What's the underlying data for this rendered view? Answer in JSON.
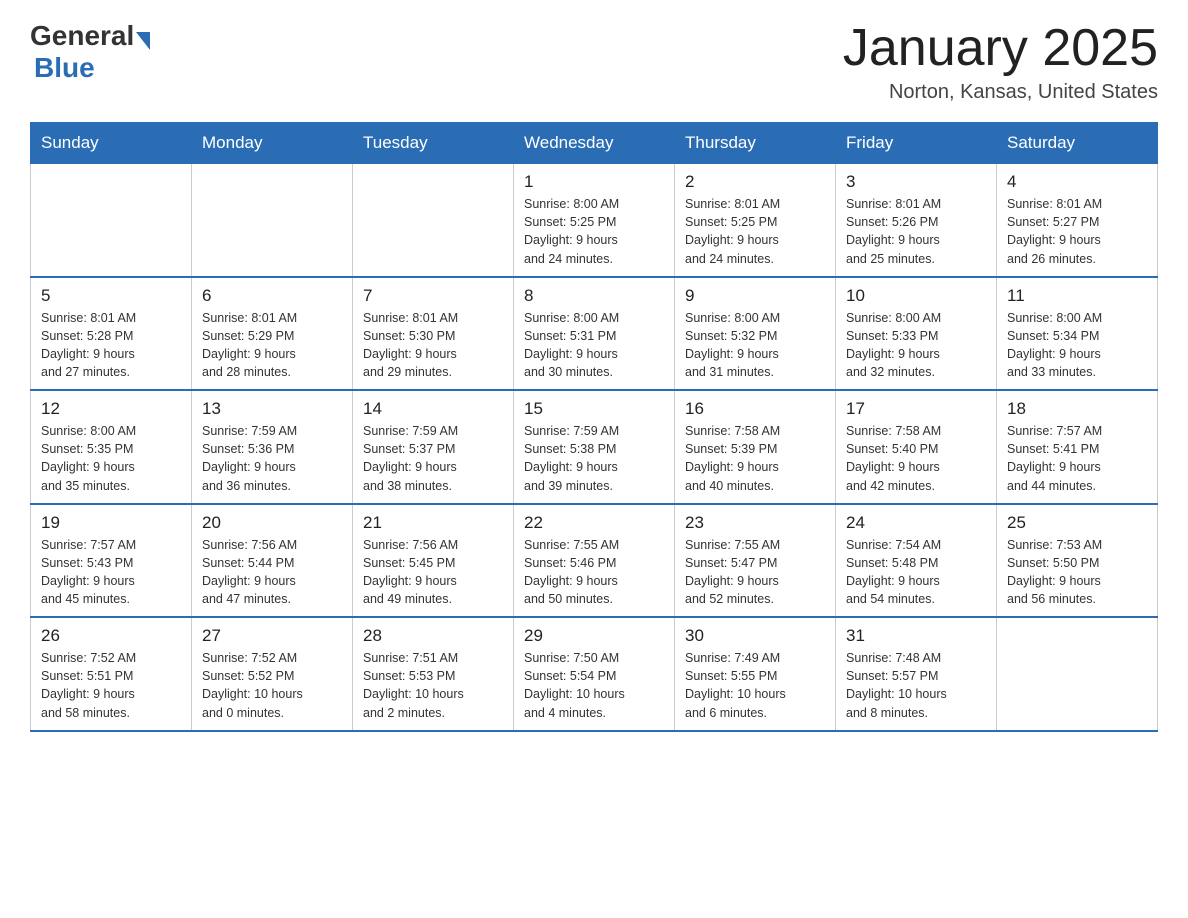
{
  "header": {
    "logo_general": "General",
    "logo_blue": "Blue",
    "month_title": "January 2025",
    "location": "Norton, Kansas, United States"
  },
  "days_of_week": [
    "Sunday",
    "Monday",
    "Tuesday",
    "Wednesday",
    "Thursday",
    "Friday",
    "Saturday"
  ],
  "weeks": [
    {
      "days": [
        {
          "num": "",
          "info": ""
        },
        {
          "num": "",
          "info": ""
        },
        {
          "num": "",
          "info": ""
        },
        {
          "num": "1",
          "info": "Sunrise: 8:00 AM\nSunset: 5:25 PM\nDaylight: 9 hours\nand 24 minutes."
        },
        {
          "num": "2",
          "info": "Sunrise: 8:01 AM\nSunset: 5:25 PM\nDaylight: 9 hours\nand 24 minutes."
        },
        {
          "num": "3",
          "info": "Sunrise: 8:01 AM\nSunset: 5:26 PM\nDaylight: 9 hours\nand 25 minutes."
        },
        {
          "num": "4",
          "info": "Sunrise: 8:01 AM\nSunset: 5:27 PM\nDaylight: 9 hours\nand 26 minutes."
        }
      ]
    },
    {
      "days": [
        {
          "num": "5",
          "info": "Sunrise: 8:01 AM\nSunset: 5:28 PM\nDaylight: 9 hours\nand 27 minutes."
        },
        {
          "num": "6",
          "info": "Sunrise: 8:01 AM\nSunset: 5:29 PM\nDaylight: 9 hours\nand 28 minutes."
        },
        {
          "num": "7",
          "info": "Sunrise: 8:01 AM\nSunset: 5:30 PM\nDaylight: 9 hours\nand 29 minutes."
        },
        {
          "num": "8",
          "info": "Sunrise: 8:00 AM\nSunset: 5:31 PM\nDaylight: 9 hours\nand 30 minutes."
        },
        {
          "num": "9",
          "info": "Sunrise: 8:00 AM\nSunset: 5:32 PM\nDaylight: 9 hours\nand 31 minutes."
        },
        {
          "num": "10",
          "info": "Sunrise: 8:00 AM\nSunset: 5:33 PM\nDaylight: 9 hours\nand 32 minutes."
        },
        {
          "num": "11",
          "info": "Sunrise: 8:00 AM\nSunset: 5:34 PM\nDaylight: 9 hours\nand 33 minutes."
        }
      ]
    },
    {
      "days": [
        {
          "num": "12",
          "info": "Sunrise: 8:00 AM\nSunset: 5:35 PM\nDaylight: 9 hours\nand 35 minutes."
        },
        {
          "num": "13",
          "info": "Sunrise: 7:59 AM\nSunset: 5:36 PM\nDaylight: 9 hours\nand 36 minutes."
        },
        {
          "num": "14",
          "info": "Sunrise: 7:59 AM\nSunset: 5:37 PM\nDaylight: 9 hours\nand 38 minutes."
        },
        {
          "num": "15",
          "info": "Sunrise: 7:59 AM\nSunset: 5:38 PM\nDaylight: 9 hours\nand 39 minutes."
        },
        {
          "num": "16",
          "info": "Sunrise: 7:58 AM\nSunset: 5:39 PM\nDaylight: 9 hours\nand 40 minutes."
        },
        {
          "num": "17",
          "info": "Sunrise: 7:58 AM\nSunset: 5:40 PM\nDaylight: 9 hours\nand 42 minutes."
        },
        {
          "num": "18",
          "info": "Sunrise: 7:57 AM\nSunset: 5:41 PM\nDaylight: 9 hours\nand 44 minutes."
        }
      ]
    },
    {
      "days": [
        {
          "num": "19",
          "info": "Sunrise: 7:57 AM\nSunset: 5:43 PM\nDaylight: 9 hours\nand 45 minutes."
        },
        {
          "num": "20",
          "info": "Sunrise: 7:56 AM\nSunset: 5:44 PM\nDaylight: 9 hours\nand 47 minutes."
        },
        {
          "num": "21",
          "info": "Sunrise: 7:56 AM\nSunset: 5:45 PM\nDaylight: 9 hours\nand 49 minutes."
        },
        {
          "num": "22",
          "info": "Sunrise: 7:55 AM\nSunset: 5:46 PM\nDaylight: 9 hours\nand 50 minutes."
        },
        {
          "num": "23",
          "info": "Sunrise: 7:55 AM\nSunset: 5:47 PM\nDaylight: 9 hours\nand 52 minutes."
        },
        {
          "num": "24",
          "info": "Sunrise: 7:54 AM\nSunset: 5:48 PM\nDaylight: 9 hours\nand 54 minutes."
        },
        {
          "num": "25",
          "info": "Sunrise: 7:53 AM\nSunset: 5:50 PM\nDaylight: 9 hours\nand 56 minutes."
        }
      ]
    },
    {
      "days": [
        {
          "num": "26",
          "info": "Sunrise: 7:52 AM\nSunset: 5:51 PM\nDaylight: 9 hours\nand 58 minutes."
        },
        {
          "num": "27",
          "info": "Sunrise: 7:52 AM\nSunset: 5:52 PM\nDaylight: 10 hours\nand 0 minutes."
        },
        {
          "num": "28",
          "info": "Sunrise: 7:51 AM\nSunset: 5:53 PM\nDaylight: 10 hours\nand 2 minutes."
        },
        {
          "num": "29",
          "info": "Sunrise: 7:50 AM\nSunset: 5:54 PM\nDaylight: 10 hours\nand 4 minutes."
        },
        {
          "num": "30",
          "info": "Sunrise: 7:49 AM\nSunset: 5:55 PM\nDaylight: 10 hours\nand 6 minutes."
        },
        {
          "num": "31",
          "info": "Sunrise: 7:48 AM\nSunset: 5:57 PM\nDaylight: 10 hours\nand 8 minutes."
        },
        {
          "num": "",
          "info": ""
        }
      ]
    }
  ]
}
